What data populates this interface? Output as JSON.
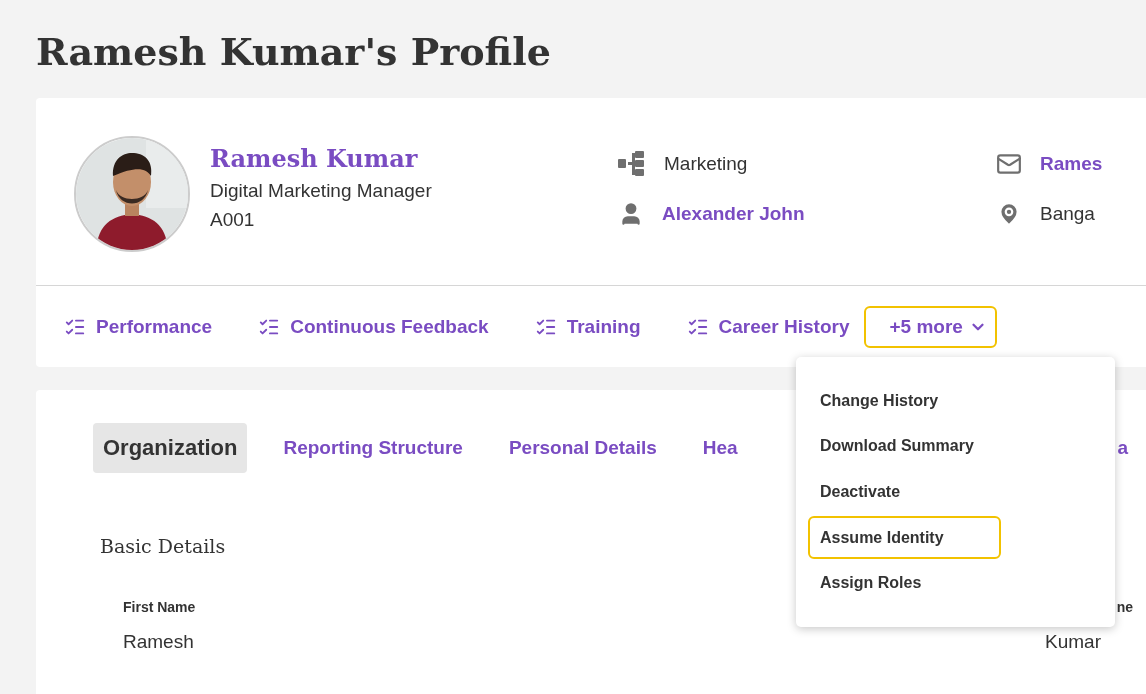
{
  "page_title": "Ramesh Kumar's Profile",
  "profile": {
    "name": "Ramesh Kumar",
    "job_title": "Digital Marketing Manager",
    "employee_id": "A001"
  },
  "details": [
    {
      "kind": "department",
      "text": "Marketing",
      "link": false
    },
    {
      "kind": "manager",
      "text": "Alexander John",
      "link": true
    },
    {
      "kind": "email",
      "text": "Rames",
      "link": true
    },
    {
      "kind": "location",
      "text": "Banga",
      "link": false
    }
  ],
  "quick_links": [
    {
      "label": "Performance"
    },
    {
      "label": "Continuous Feedback"
    },
    {
      "label": "Training"
    },
    {
      "label": "Career History"
    }
  ],
  "more_button": {
    "label": "+5 more",
    "highlighted": true,
    "expanded": true
  },
  "more_menu": [
    {
      "label": "Change History",
      "highlighted": false
    },
    {
      "label": "Download Summary",
      "highlighted": false
    },
    {
      "label": "Deactivate",
      "highlighted": false
    },
    {
      "label": "Assume Identity",
      "highlighted": true
    },
    {
      "label": "Assign Roles",
      "highlighted": false
    }
  ],
  "section_tabs": [
    {
      "label": "Organization",
      "selected": true
    },
    {
      "label": "Reporting Structure",
      "selected": false
    },
    {
      "label": "Personal Details",
      "selected": false
    },
    {
      "label": "Hea",
      "selected": false
    },
    {
      "label": "a",
      "selected": false
    }
  ],
  "section": {
    "title": "Basic Details",
    "fields": [
      {
        "label": "First Name",
        "value": "Ramesh"
      },
      {
        "label": "ne",
        "value": "Kumar"
      }
    ]
  }
}
